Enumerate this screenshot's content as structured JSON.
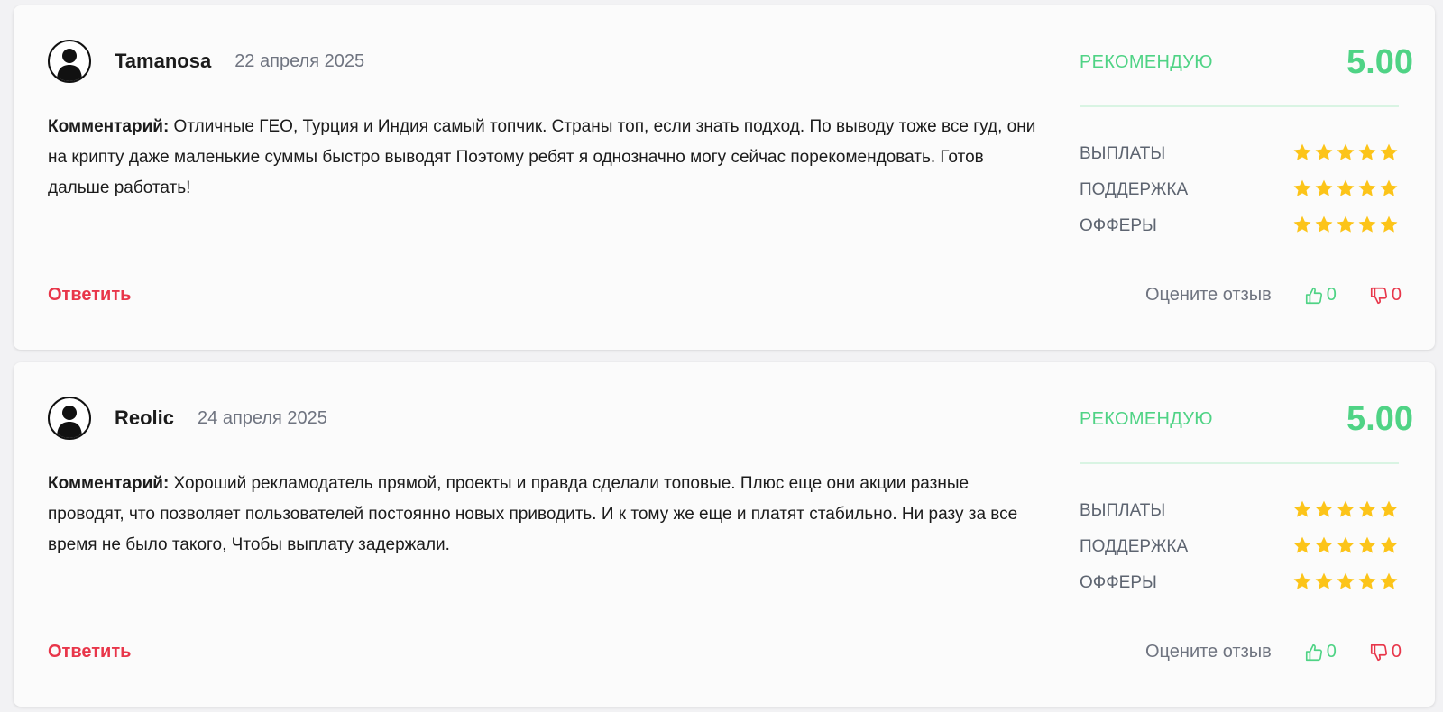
{
  "reviews": [
    {
      "author": "Tamanosa",
      "date": "22 апреля 2025",
      "comment_label": "Комментарий:",
      "comment_text": " Отличные ГЕО, Турция и Индия самый топчик. Страны топ, если знать подход. По выводу тоже все гуд, они на крипту даже маленькие суммы быстро выводят Поэтому ребят я однозначно могу сейчас порекомендовать. Готов дальше работать!",
      "verdict": "РЕКОМЕНДУЮ",
      "score": "5.00",
      "criteria": [
        {
          "label": "ВЫПЛАТЫ",
          "stars": 5
        },
        {
          "label": "ПОДДЕРЖКА",
          "stars": 5
        },
        {
          "label": "ОФФЕРЫ",
          "stars": 5
        }
      ],
      "reply_label": "Ответить",
      "rate_label": "Оцените отзыв",
      "likes": "0",
      "dislikes": "0"
    },
    {
      "author": "Reolic",
      "date": "24 апреля 2025",
      "comment_label": "Комментарий:",
      "comment_text": " Хороший рекламодатель прямой, проекты и правда сделали топовые. Плюс еще они акции разные проводят, что позволяет пользователей постоянно новых приводить. И к тому же еще и платят стабильно. Ни разу за все время не было такого, Чтобы выплату задержали.",
      "verdict": "РЕКОМЕНДУЮ",
      "score": "5.00",
      "criteria": [
        {
          "label": "ВЫПЛАТЫ",
          "stars": 5
        },
        {
          "label": "ПОДДЕРЖКА",
          "stars": 5
        },
        {
          "label": "ОФФЕРЫ",
          "stars": 5
        }
      ],
      "reply_label": "Ответить",
      "rate_label": "Оцените отзыв",
      "likes": "0",
      "dislikes": "0"
    }
  ],
  "colors": {
    "accent_green": "#4fd385",
    "accent_red": "#e8364a",
    "star": "#fcc419"
  },
  "icons": {
    "avatar": "user-silhouette-icon",
    "star": "star-icon",
    "like": "thumbs-up-icon",
    "dislike": "thumbs-down-icon"
  }
}
